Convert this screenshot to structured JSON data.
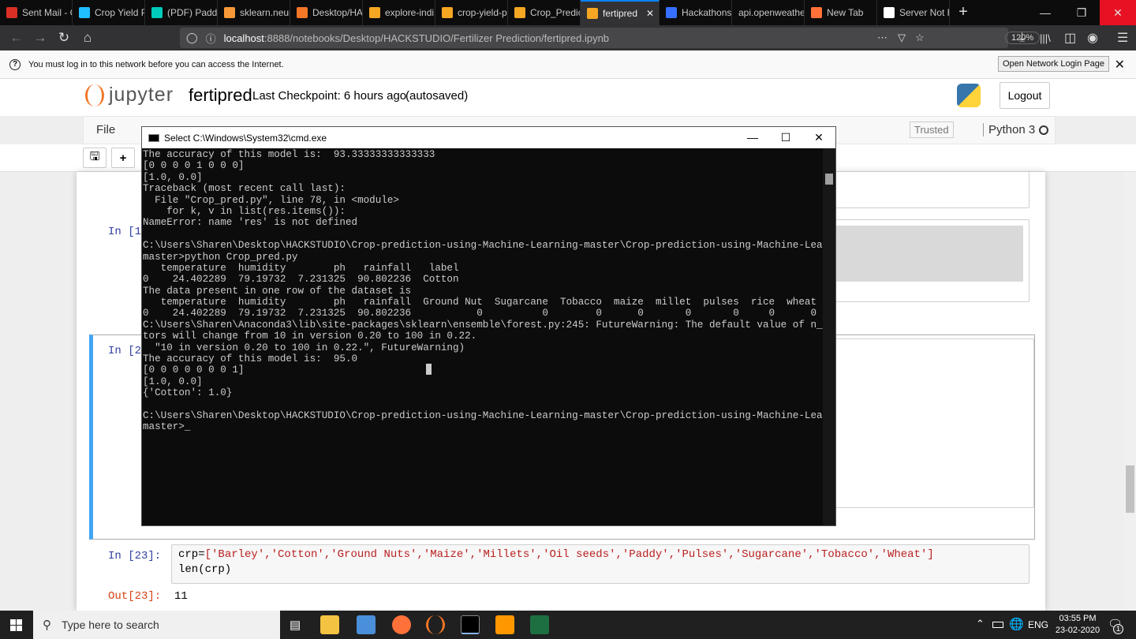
{
  "browser": {
    "tabs": [
      {
        "label": "Sent Mail - Gmail",
        "icon": "gmail-icon",
        "color": "#d93025"
      },
      {
        "label": "Crop Yield P",
        "icon": "kaggle-icon",
        "color": "#20beff"
      },
      {
        "label": "(PDF) Paddy",
        "icon": "researchgate-icon",
        "color": "#00ccbb"
      },
      {
        "label": "sklearn.neur",
        "icon": "sklearn-icon",
        "color": "#f89939"
      },
      {
        "label": "Desktop/HA",
        "icon": "jupyter-icon",
        "color": "#f37726"
      },
      {
        "label": "explore-indi",
        "icon": "notebook-icon",
        "color": "#f5a623"
      },
      {
        "label": "crop-yield-p",
        "icon": "notebook-icon",
        "color": "#f5a623"
      },
      {
        "label": "Crop_Predic",
        "icon": "notebook-icon",
        "color": "#f5a623"
      },
      {
        "label": "fertipred",
        "icon": "notebook-icon",
        "color": "#f5a623",
        "active": true
      },
      {
        "label": "Hackathons",
        "icon": "devfolio-icon",
        "color": "#3770ff"
      },
      {
        "label": "api.openweathe",
        "icon": "",
        "color": ""
      },
      {
        "label": "New Tab",
        "icon": "firefox-icon",
        "color": "#ff7139"
      },
      {
        "label": "Server Not F",
        "icon": "warning-icon",
        "color": "#ffffff"
      }
    ],
    "url_host": "localhost",
    "url_rest": ":8888/notebooks/Desktop/HACKSTUDIO/Fertilizer Prediction/fertipred.ipynb",
    "zoom": "120%",
    "notification": "You must log in to this network before you can access the Internet.",
    "login_button": "Open Network Login Page"
  },
  "jupyter": {
    "logo_text": "jupyter",
    "notebook_name": "fertipred",
    "checkpoint": "Last Checkpoint: 6 hours ago",
    "autosaved": "(autosaved)",
    "logout": "Logout",
    "menu_file": "File",
    "trusted": "Trusted",
    "kernel": "Python 3",
    "cell_prompt_1": "In [1",
    "cell_prompt_2": "In [2",
    "cell23_prompt": "In [23]:",
    "cell23_code_prefix": "crp=",
    "cell23_list": "['Barley','Cotton','Ground Nuts','Maize','Millets','Oil seeds','Paddy','Pulses','Sugarcane','Tobacco','Wheat']",
    "cell23_line2": "len(crp)",
    "out23_prompt": "Out[23]:",
    "out23_value": "11"
  },
  "cmd": {
    "title": "Select C:\\Windows\\System32\\cmd.exe",
    "lines": [
      "The accuracy of this model is:  93.33333333333333",
      "[0 0 0 0 1 0 0 0]",
      "[1.0, 0.0]",
      "Traceback (most recent call last):",
      "  File \"Crop_pred.py\", line 78, in <module>",
      "    for k, v in list(res.items()):",
      "NameError: name 'res' is not defined",
      "",
      "C:\\Users\\Sharen\\Desktop\\HACKSTUDIO\\Crop-prediction-using-Machine-Learning-master\\Crop-prediction-using-Machine-Learning-",
      "master>python Crop_pred.py",
      "   temperature  humidity        ph   rainfall   label",
      "0    24.402289  79.19732  7.231325  90.802236  Cotton",
      "The data present in one row of the dataset is",
      "   temperature  humidity        ph   rainfall  Ground Nut  Sugarcane  Tobacco  maize  millet  pulses  rice  wheat",
      "0    24.402289  79.19732  7.231325  90.802236           0          0        0      0       0       0     0      0",
      "C:\\Users\\Sharen\\Anaconda3\\lib\\site-packages\\sklearn\\ensemble\\forest.py:245: FutureWarning: The default value of n_estima",
      "tors will change from 10 in version 0.20 to 100 in 0.22.",
      "  \"10 in version 0.20 to 100 in 0.22.\", FutureWarning)",
      "The accuracy of this model is:  95.0",
      "[0 0 0 0 0 0 0 1]",
      "[1.0, 0.0]",
      "{'Cotton': 1.0}",
      "",
      "C:\\Users\\Sharen\\Desktop\\HACKSTUDIO\\Crop-prediction-using-Machine-Learning-master\\Crop-prediction-using-Machine-Learning-",
      "master>_"
    ]
  },
  "taskbar": {
    "search_placeholder": "Type here to search",
    "language": "ENG",
    "time": "03:55 PM",
    "date": "23-02-2020",
    "notifications": "1"
  }
}
